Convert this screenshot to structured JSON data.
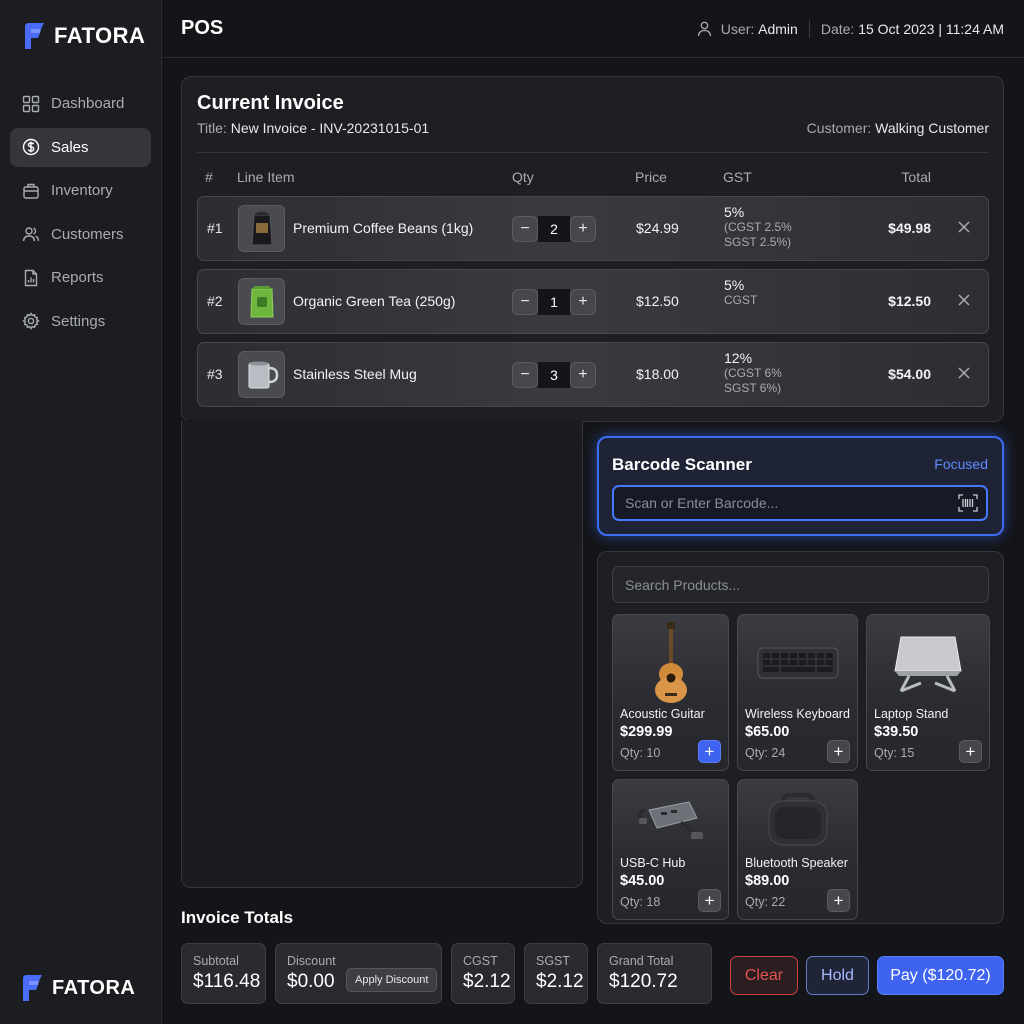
{
  "brand": {
    "name": "FATORA",
    "color": "#4a6cf7"
  },
  "sidebar": {
    "items": [
      {
        "label": "Dashboard",
        "icon": "grid-icon"
      },
      {
        "label": "Sales",
        "icon": "dollar-icon",
        "active": true
      },
      {
        "label": "Inventory",
        "icon": "box-icon"
      },
      {
        "label": "Customers",
        "icon": "users-icon"
      },
      {
        "label": "Reports",
        "icon": "report-icon"
      },
      {
        "label": "Settings",
        "icon": "gear-icon"
      }
    ]
  },
  "header": {
    "title": "POS",
    "user_label": "User:",
    "user_value": "Admin",
    "date_label": "Date:",
    "date_value": "15 Oct 2023 | 11:24 AM"
  },
  "invoice": {
    "heading": "Current Invoice",
    "title_label": "Title:",
    "title_value": "New Invoice - INV-20231015-01",
    "customer_label": "Customer:",
    "customer_value": "Walking Customer",
    "columns": {
      "num": "#",
      "item": "Line Item",
      "qty": "Qty",
      "price": "Price",
      "gst": "GST",
      "total": "Total"
    },
    "rows": [
      {
        "num": "#1",
        "name": "Premium Coffee Beans (1kg)",
        "qty": "2",
        "price": "$24.99",
        "gst": "5%",
        "gst_detail_1": "(CGST 2.5%",
        "gst_detail_2": "SGST 2.5%)",
        "total": "$49.98",
        "thumb": "coffee-bag-icon"
      },
      {
        "num": "#2",
        "name": "Organic Green Tea (250g)",
        "qty": "1",
        "price": "$12.50",
        "gst": "5%",
        "gst_detail_1": "CGST",
        "gst_detail_2": "",
        "total": "$12.50",
        "thumb": "tea-pack-icon"
      },
      {
        "num": "#3",
        "name": "Stainless Steel Mug",
        "qty": "3",
        "price": "$18.00",
        "gst": "12%",
        "gst_detail_1": "(CGST 6%",
        "gst_detail_2": "SGST 6%)",
        "total": "$54.00",
        "thumb": "mug-icon"
      }
    ]
  },
  "barcode": {
    "title": "Barcode Scanner",
    "state": "Focused",
    "placeholder": "Scan or Enter Barcode...",
    "value": ""
  },
  "products": {
    "search_placeholder": "Search Products...",
    "items": [
      {
        "name": "Acoustic Guitar",
        "price": "$299.99",
        "qty": "Qty: 10",
        "icon": "guitar-icon",
        "highlight": true
      },
      {
        "name": "Wireless Keyboard",
        "price": "$65.00",
        "qty": "Qty: 24",
        "icon": "keyboard-icon"
      },
      {
        "name": "Laptop Stand",
        "price": "$39.50",
        "qty": "Qty: 15",
        "icon": "laptop-stand-icon"
      },
      {
        "name": "USB-C Hub",
        "price": "$45.00",
        "qty": "Qty: 18",
        "icon": "usb-hub-icon"
      },
      {
        "name": "Bluetooth Speaker",
        "price": "$89.00",
        "qty": "Qty: 22",
        "icon": "speaker-icon"
      }
    ]
  },
  "totals": {
    "heading": "Invoice Totals",
    "subtotal_label": "Subtotal",
    "subtotal": "$116.48",
    "discount_label": "Discount",
    "discount": "$0.00",
    "apply_discount": "Apply Discount",
    "cgst_label": "CGST",
    "cgst": "$2.12",
    "sgst_label": "SGST",
    "sgst": "$2.12",
    "grand_label": "Grand Total",
    "grand": "$120.72"
  },
  "actions": {
    "clear": "Clear",
    "hold": "Hold",
    "pay": "Pay ($120.72)"
  },
  "colors": {
    "accent": "#3d63f0",
    "danger": "#e5524f",
    "focus": "#4677ff"
  }
}
